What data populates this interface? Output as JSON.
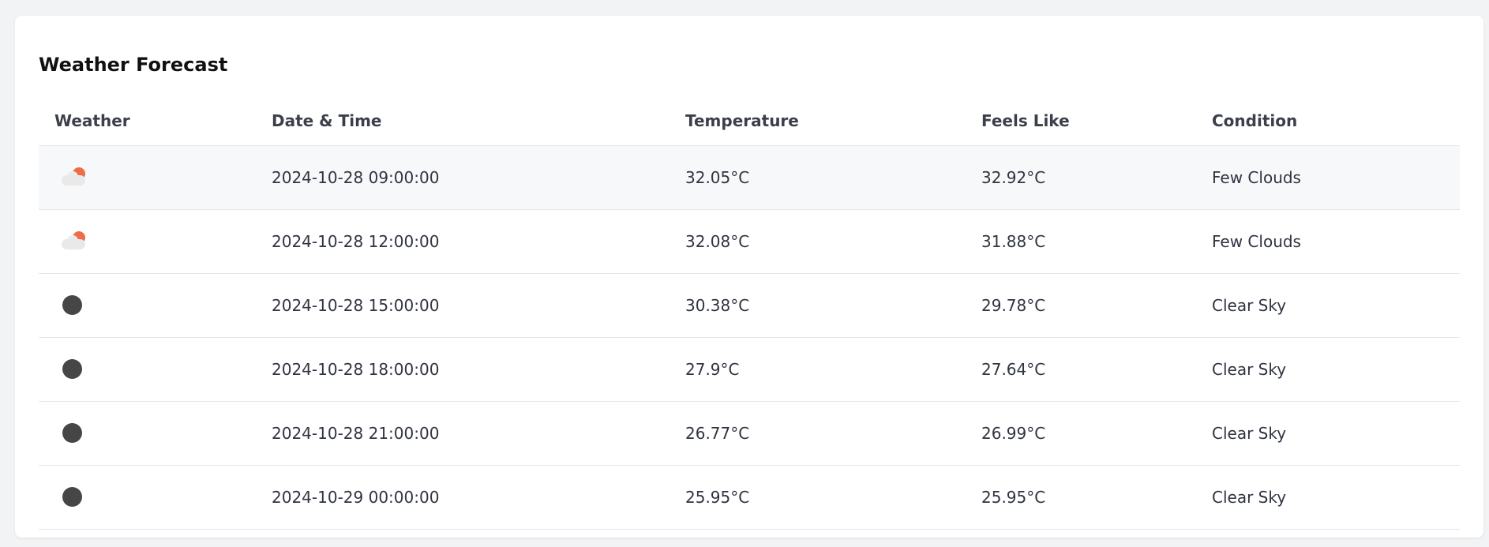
{
  "title": "Weather Forecast",
  "columns": {
    "weather": "Weather",
    "datetime": "Date & Time",
    "temperature": "Temperature",
    "feels_like": "Feels Like",
    "condition": "Condition"
  },
  "colors": {
    "sun_accent": "#ef6c4a",
    "cloud": "#e9e9e9",
    "night_icon": "#464646"
  },
  "rows": [
    {
      "icon": "few-clouds-day-icon",
      "datetime": "2024-10-28 09:00:00",
      "temperature": "32.05°C",
      "feels_like": "32.92°C",
      "condition": "Few Clouds"
    },
    {
      "icon": "few-clouds-day-icon",
      "datetime": "2024-10-28 12:00:00",
      "temperature": "32.08°C",
      "feels_like": "31.88°C",
      "condition": "Few Clouds"
    },
    {
      "icon": "clear-night-icon",
      "datetime": "2024-10-28 15:00:00",
      "temperature": "30.38°C",
      "feels_like": "29.78°C",
      "condition": "Clear Sky"
    },
    {
      "icon": "clear-night-icon",
      "datetime": "2024-10-28 18:00:00",
      "temperature": "27.9°C",
      "feels_like": "27.64°C",
      "condition": "Clear Sky"
    },
    {
      "icon": "clear-night-icon",
      "datetime": "2024-10-28 21:00:00",
      "temperature": "26.77°C",
      "feels_like": "26.99°C",
      "condition": "Clear Sky"
    },
    {
      "icon": "clear-night-icon",
      "datetime": "2024-10-29 00:00:00",
      "temperature": "25.95°C",
      "feels_like": "25.95°C",
      "condition": "Clear Sky"
    }
  ]
}
